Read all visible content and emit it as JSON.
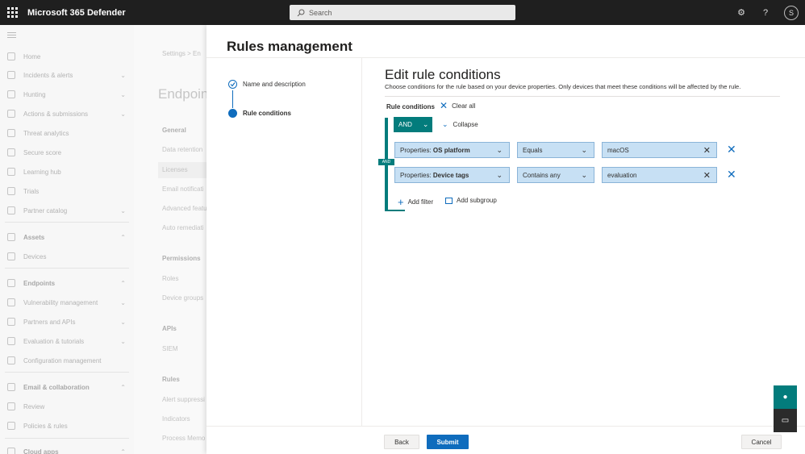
{
  "topbar": {
    "app_title": "Microsoft 365 Defender",
    "search_placeholder": "Search",
    "avatar_initial": "S"
  },
  "leftnav": {
    "items": [
      {
        "label": "Home",
        "chevron": false
      },
      {
        "label": "Incidents & alerts",
        "chevron": true
      },
      {
        "label": "Hunting",
        "chevron": true
      },
      {
        "label": "Actions & submissions",
        "chevron": true
      },
      {
        "label": "Threat analytics",
        "chevron": false
      },
      {
        "label": "Secure score",
        "chevron": false
      },
      {
        "label": "Learning hub",
        "chevron": false
      },
      {
        "label": "Trials",
        "chevron": false
      },
      {
        "label": "Partner catalog",
        "chevron": true
      },
      {
        "label": "Assets",
        "chevron": true,
        "section": true
      },
      {
        "label": "Devices",
        "chevron": false
      },
      {
        "label": "Endpoints",
        "chevron": true,
        "section": true
      },
      {
        "label": "Vulnerability management",
        "chevron": true
      },
      {
        "label": "Partners and APIs",
        "chevron": true
      },
      {
        "label": "Evaluation & tutorials",
        "chevron": true
      },
      {
        "label": "Configuration management",
        "chevron": false
      },
      {
        "label": "Email & collaboration",
        "chevron": true,
        "section": true
      },
      {
        "label": "Review",
        "chevron": false
      },
      {
        "label": "Policies & rules",
        "chevron": false
      },
      {
        "label": "Cloud apps",
        "chevron": true,
        "section": true
      }
    ]
  },
  "bgpage": {
    "breadcrumb": "Settings  >  En",
    "title": "Endpoin",
    "general_head": "General",
    "general_links": [
      "Data retention",
      "Licenses",
      "Email notificati",
      "Advanced featu",
      "Auto remediati"
    ],
    "permissions_head": "Permissions",
    "permissions_links": [
      "Roles",
      "Device groups"
    ],
    "apis_head": "APIs",
    "apis_links": [
      "SIEM"
    ],
    "rules_head": "Rules",
    "rules_links": [
      "Alert suppressi",
      "Indicators",
      "Process Memo"
    ]
  },
  "panel": {
    "title": "Rules management",
    "steps": [
      {
        "label": "Name and description",
        "state": "done"
      },
      {
        "label": "Rule conditions",
        "state": "active"
      }
    ],
    "edit_title": "Edit rule conditions",
    "edit_desc": "Choose conditions for the rule based on your device properties. Only devices that meet these conditions will be affected by the rule.",
    "rule_conditions_label": "Rule conditions",
    "clear_all": "Clear all",
    "operator": "AND",
    "operator_tag": "AND",
    "collapse": "Collapse",
    "conditions": [
      {
        "property_prefix": "Properties: ",
        "property_name": "OS platform",
        "operator": "Equals",
        "value": "macOS"
      },
      {
        "property_prefix": "Properties: ",
        "property_name": "Device tags",
        "operator": "Contains any",
        "value": "evaluation"
      }
    ],
    "add_filter": "Add filter",
    "add_subgroup": "Add subgroup",
    "buttons": {
      "back": "Back",
      "submit": "Submit",
      "cancel": "Cancel"
    }
  },
  "colors": {
    "accent": "#0f6cbd",
    "group": "#037c7c",
    "field_bg": "#c7e0f4"
  }
}
